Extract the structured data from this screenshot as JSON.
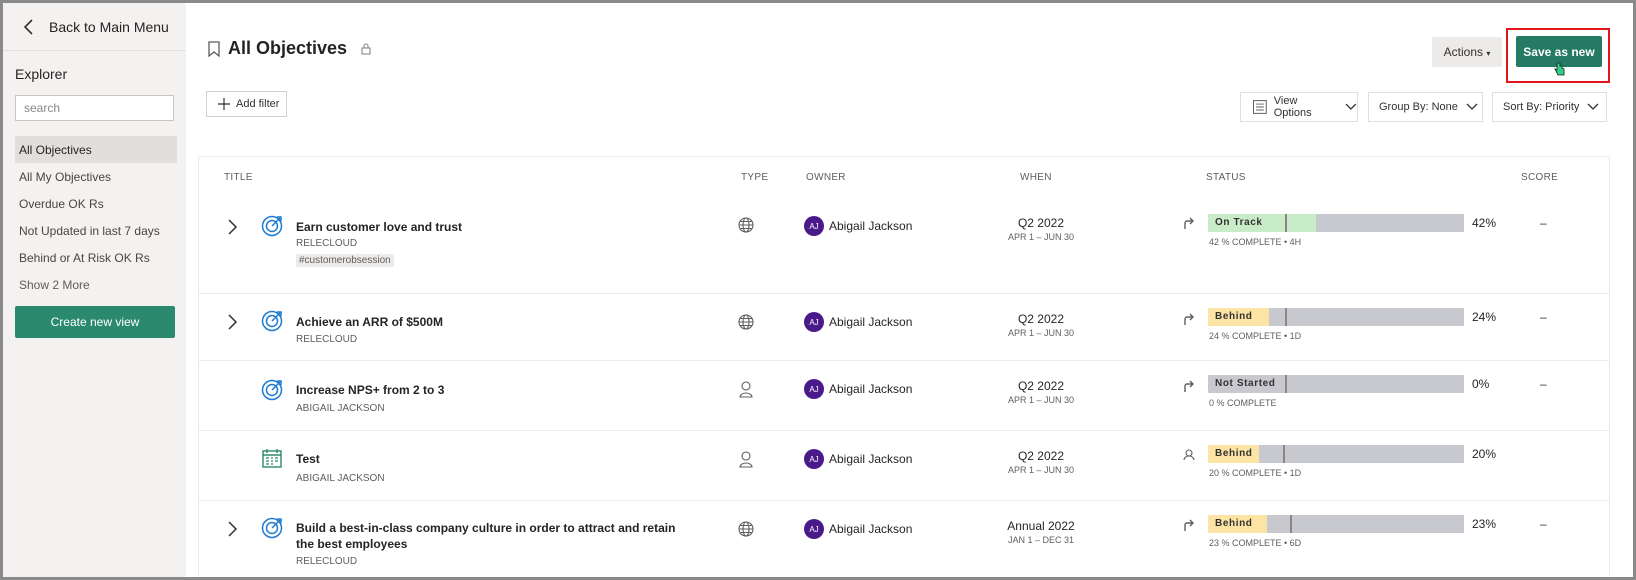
{
  "sidebar": {
    "back_label": "Back to Main Menu",
    "explorer_title": "Explorer",
    "search_placeholder": "search",
    "items": [
      {
        "label": "All Objectives",
        "active": true
      },
      {
        "label": "All My Objectives",
        "active": false
      },
      {
        "label": "Overdue OK Rs",
        "active": false
      },
      {
        "label": "Not Updated in last 7 days",
        "active": false
      },
      {
        "label": "Behind or At Risk OK Rs",
        "active": false
      },
      {
        "label": "Show 2 More",
        "active": false
      }
    ],
    "create_label": "Create new view"
  },
  "header": {
    "title": "All Objectives",
    "actions_label": "Actions",
    "save_label": "Save as new",
    "add_filter_label": "Add filter",
    "view_options_label": "View Options",
    "group_by_label": "Group By: None",
    "sort_by_label": "Sort By: Priority"
  },
  "columns": {
    "title": "TITLE",
    "type": "TYPE",
    "owner": "OWNER",
    "when": "WHEN",
    "status": "STATUS",
    "score": "SCORE"
  },
  "colors": {
    "on_track": "#c9ecc8",
    "behind": "#fbe4a4",
    "bar_bg": "#c8c9cf",
    "accent": "#247a62",
    "objective_icon": "#1d7bd1",
    "kr_icon": "#2b8a6e"
  },
  "rows": [
    {
      "title": "Earn customer love and trust",
      "subtitle": "RELECLOUD",
      "tag": "#customerobsession",
      "expandable": true,
      "icon": "objective-target-icon",
      "type_icon": "globe-icon",
      "owner_initials": "AJ",
      "owner": "Abigail Jackson",
      "when": "Q2 2022",
      "when_range": "APR 1 – JUN 30",
      "trend_icon": "trend-arrow-icon",
      "status": "On Track",
      "status_color": "#c9ecc8",
      "progress": 0.42,
      "percent": "42%",
      "complete": "42 % COMPLETE • 4H",
      "score": "–"
    },
    {
      "title": "Achieve an ARR of $500M",
      "subtitle": "RELECLOUD",
      "tag": "",
      "expandable": true,
      "icon": "objective-target-icon",
      "type_icon": "globe-icon",
      "owner_initials": "AJ",
      "owner": "Abigail Jackson",
      "when": "Q2 2022",
      "when_range": "APR 1 – JUN 30",
      "trend_icon": "trend-arrow-icon",
      "status": "Behind",
      "status_color": "#fbe4a4",
      "progress": 0.24,
      "percent": "24%",
      "complete": "24 % COMPLETE • 1D",
      "score": "–"
    },
    {
      "title": "Increase NPS+ from 2 to 3",
      "subtitle": "ABIGAIL JACKSON",
      "tag": "",
      "expandable": false,
      "icon": "objective-target-icon",
      "type_icon": "person-icon",
      "owner_initials": "AJ",
      "owner": "Abigail Jackson",
      "when": "Q2 2022",
      "when_range": "APR 1 – JUN 30",
      "trend_icon": "trend-arrow-icon",
      "status": "Not Started",
      "status_color": "#c8c9cf",
      "progress": 0,
      "percent": "0%",
      "complete": "0 % COMPLETE",
      "score": "–"
    },
    {
      "title": "Test",
      "subtitle": "ABIGAIL JACKSON",
      "tag": "",
      "expandable": false,
      "icon": "key-result-calendar-icon",
      "type_icon": "person-icon",
      "owner_initials": "AJ",
      "owner": "Abigail Jackson",
      "when": "Q2 2022",
      "when_range": "APR 1 – JUN 30",
      "trend_icon": "person-outline-icon",
      "status": "Behind",
      "status_color": "#fbe4a4",
      "progress": 0.2,
      "percent": "20%",
      "complete": "20 % COMPLETE • 1D",
      "score": ""
    },
    {
      "title": "Build a best-in-class company culture in order to attract and retain the best employees",
      "subtitle": "RELECLOUD",
      "tag": "",
      "expandable": true,
      "icon": "objective-target-icon",
      "type_icon": "globe-icon",
      "owner_initials": "AJ",
      "owner": "Abigail Jackson",
      "when": "Annual 2022",
      "when_range": "JAN 1 – DEC 31",
      "trend_icon": "trend-arrow-icon",
      "status": "Behind",
      "status_color": "#fbe4a4",
      "progress": 0.23,
      "percent": "23%",
      "complete": "23 % COMPLETE • 6D",
      "score": "–"
    }
  ]
}
